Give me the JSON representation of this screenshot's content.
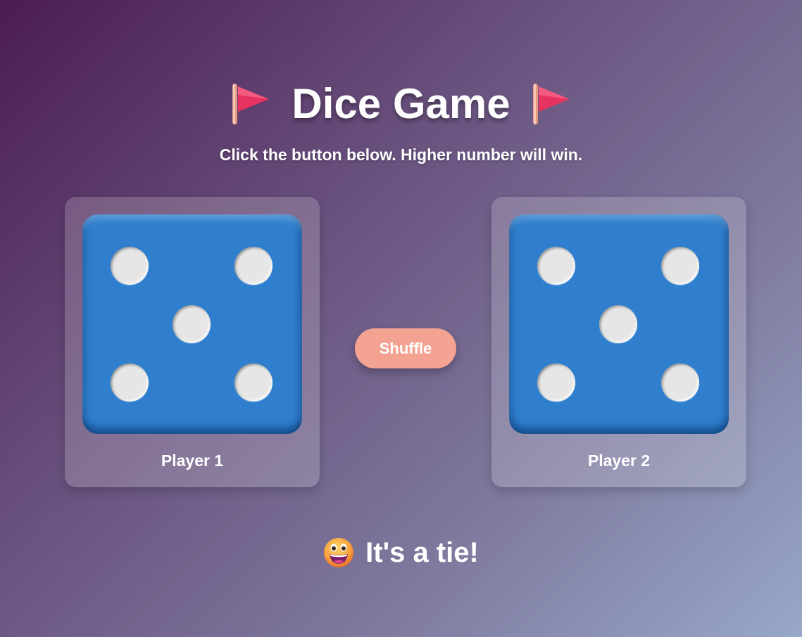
{
  "header": {
    "title": "Dice Game",
    "title_icon": "red-triangular-flag-icon",
    "subtitle": "Click the button below. Higher number will win."
  },
  "players": [
    {
      "label": "Player 1",
      "die_value": 5,
      "die_color": "#2f7fce"
    },
    {
      "label": "Player 2",
      "die_value": 5,
      "die_color": "#2f7fce"
    }
  ],
  "controls": {
    "shuffle_label": "Shuffle",
    "shuffle_color": "#f4a392"
  },
  "result": {
    "text": "It's a tie!",
    "icon": "grinning-face-icon"
  }
}
